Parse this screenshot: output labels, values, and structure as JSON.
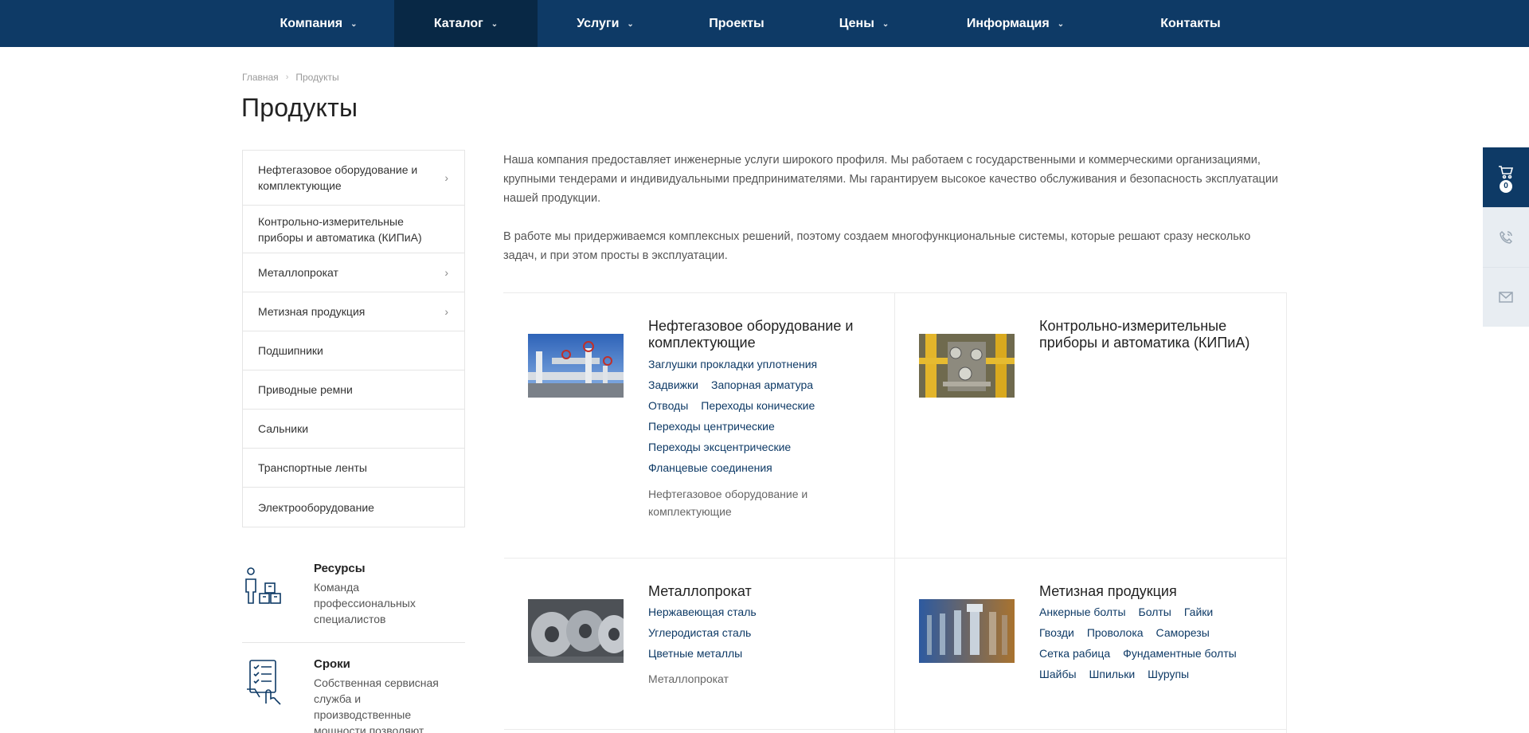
{
  "nav": {
    "items": [
      {
        "label": "Компания",
        "has_dropdown": true,
        "active": false
      },
      {
        "label": "Каталог",
        "has_dropdown": true,
        "active": true
      },
      {
        "label": "Услуги",
        "has_dropdown": true,
        "active": false
      },
      {
        "label": "Проекты",
        "has_dropdown": false,
        "active": false
      },
      {
        "label": "Цены",
        "has_dropdown": true,
        "active": false
      },
      {
        "label": "Информация",
        "has_dropdown": true,
        "active": false
      },
      {
        "label": "Контакты",
        "has_dropdown": false,
        "active": false
      }
    ]
  },
  "breadcrumb": {
    "home": "Главная",
    "current": "Продукты"
  },
  "page": {
    "title": "Продукты"
  },
  "sidebar": {
    "items": [
      {
        "label": "Нефтегазовое оборудование и комплектующие",
        "has_arrow": true
      },
      {
        "label": "Контрольно-измерительные приборы и автоматика (КИПиА)",
        "has_arrow": false
      },
      {
        "label": "Металлопрокат",
        "has_arrow": true
      },
      {
        "label": "Метизная продукция",
        "has_arrow": true
      },
      {
        "label": "Подшипники",
        "has_arrow": false
      },
      {
        "label": "Приводные ремни",
        "has_arrow": false
      },
      {
        "label": "Сальники",
        "has_arrow": false
      },
      {
        "label": "Транспортные ленты",
        "has_arrow": false
      },
      {
        "label": "Электрооборудование",
        "has_arrow": false
      }
    ]
  },
  "features": [
    {
      "title": "Ресурсы",
      "text": "Команда профессиональных специалистов",
      "icon": "team-boxes-icon"
    },
    {
      "title": "Сроки",
      "text": "Собственная сервисная служба и производственные мощности позволяют",
      "icon": "checklist-hand-icon"
    }
  ],
  "intro": {
    "p1": "Наша компания предоставляет инженерные услуги широкого профиля. Мы работаем с государственными и коммерческими организациями, крупными тендерами и индивидуальными предпринимателями. Мы гарантируем высокое качество обслуживания и безопасность эксплуатации нашей продукции.",
    "p2": "В работе мы придерживаемся комплексных решений, поэтому создаем многофункциональные системы, которые решают сразу несколько задач, и при этом просты в эксплуатации."
  },
  "cards": [
    {
      "title": "Нефтегазовое оборудование и комплектующие",
      "image": "pipeline-valves-photo",
      "links": [
        [
          "Заглушки прокладки уплотнения"
        ],
        [
          "Задвижки",
          "Запорная арматура"
        ],
        [
          "Отводы",
          "Переходы конические"
        ],
        [
          "Переходы центрические"
        ],
        [
          "Переходы эксцентрические"
        ],
        [
          "Фланцевые соединения"
        ]
      ],
      "desc": "Нефтегазовое оборудование и комплектующие"
    },
    {
      "title": "Контрольно-измерительные приборы и автоматика (КИПиА)",
      "image": "gauges-yellow-pipes-photo",
      "links": [],
      "desc": ""
    },
    {
      "title": "Металлопрокат",
      "image": "steel-coils-photo",
      "links": [
        [
          "Нержавеющая сталь"
        ],
        [
          "Углеродистая сталь"
        ],
        [
          "Цветные металлы"
        ]
      ],
      "desc": "Металлопрокат"
    },
    {
      "title": "Метизная продукция",
      "image": "bolts-nuts-photo",
      "links": [
        [
          "Анкерные болты",
          "Болты",
          "Гайки"
        ],
        [
          "Гвозди",
          "Проволока",
          "Саморезы"
        ],
        [
          "Сетка рабица",
          "Фундаментные болты"
        ],
        [
          "Шайбы",
          "Шпильки",
          "Шурупы"
        ]
      ],
      "desc": ""
    }
  ],
  "float_panel": {
    "cart_count": "0",
    "icons": [
      "cart-icon",
      "phone-icon",
      "mail-icon"
    ]
  },
  "colors": {
    "primary": "#0e3a66",
    "active_nav": "#082845",
    "link": "#0e3a66"
  }
}
